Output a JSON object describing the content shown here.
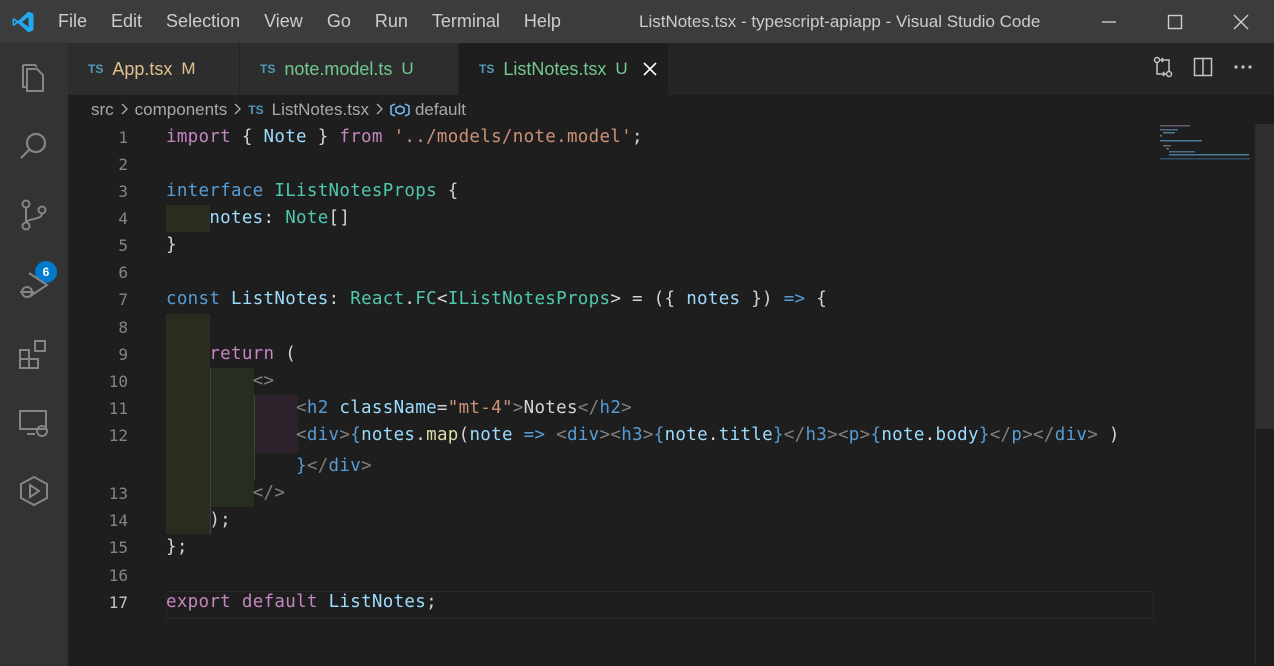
{
  "window": {
    "title": "ListNotes.tsx - typescript-apiapp - Visual Studio Code",
    "controls": [
      "minimize-icon",
      "maximize-icon",
      "close-icon"
    ]
  },
  "menu": [
    "File",
    "Edit",
    "Selection",
    "View",
    "Go",
    "Run",
    "Terminal",
    "Help"
  ],
  "activity_bar": {
    "items": [
      "explorer-icon",
      "search-icon",
      "source-control-icon",
      "run-debug-icon",
      "extensions-icon",
      "remote-explorer-icon",
      "live-share-icon"
    ],
    "source_control_badge": "6"
  },
  "tabs": [
    {
      "badge": "TS",
      "label": "App.tsx",
      "status": "M",
      "color": "#e2c08d",
      "active": false
    },
    {
      "badge": "TS",
      "label": "note.model.ts",
      "status": "U",
      "color": "#73c991",
      "active": false
    },
    {
      "badge": "TS",
      "label": "ListNotes.tsx",
      "status": "U",
      "color": "#73c991",
      "active": true
    }
  ],
  "editor_actions": [
    "open-changes-icon",
    "split-editor-icon",
    "more-actions-icon"
  ],
  "breadcrumb": {
    "items": [
      "src",
      "components",
      "ListNotes.tsx",
      "default"
    ],
    "file_badge": "TS"
  },
  "editor": {
    "current_line": "17",
    "line_numbers": [
      "1",
      "2",
      "3",
      "4",
      "5",
      "6",
      "7",
      "8",
      "9",
      "10",
      "11",
      "12",
      "",
      "13",
      "14",
      "15",
      "16",
      "17"
    ],
    "lines": [
      "import { Note } from '../models/note.model';",
      "",
      "interface IListNotesProps {",
      "    notes: Note[]",
      "}",
      "",
      "const ListNotes: React.FC<IListNotesProps> = ({ notes }) => {",
      "",
      "    return (",
      "        <>",
      "            <h2 className=\"mt-4\">Notes</h2>",
      "            <div>{notes.map(note => <div><h3>{note.title}</h3><p>{note.body}</p></div> )",
      "            }</div>",
      "        </>",
      "    );",
      "};",
      "",
      "export default ListNotes;"
    ]
  },
  "colors": {
    "keyword": "#c586c0",
    "storage": "#569cd6",
    "type": "#4ec9b0",
    "variable": "#9cdcfe",
    "string": "#ce9178",
    "function": "#dcdcaa",
    "accent": "#007acc"
  }
}
